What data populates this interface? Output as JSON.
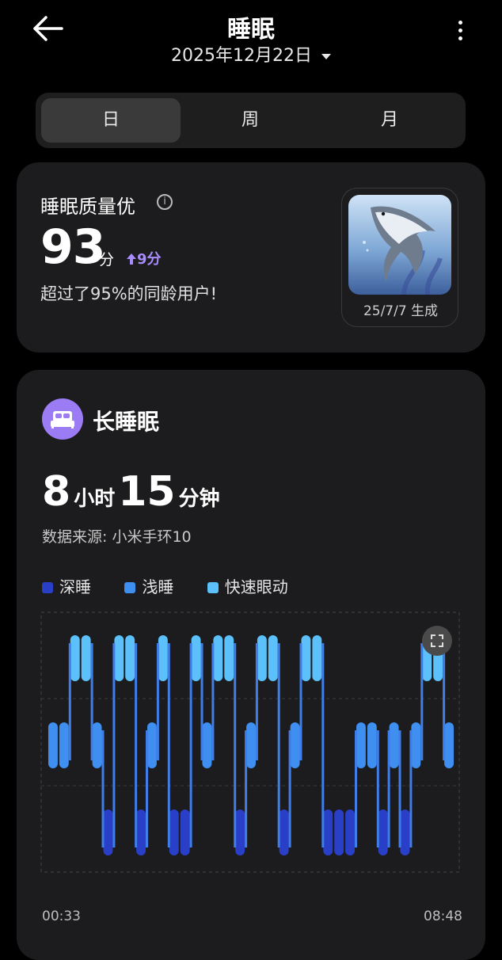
{
  "header": {
    "title": "睡眠",
    "date": "2025年12月22日"
  },
  "tabs": [
    {
      "label": "日",
      "active": true
    },
    {
      "label": "周",
      "active": false
    },
    {
      "label": "月",
      "active": false
    }
  ],
  "quality": {
    "title": "睡眠质量优",
    "score": "93",
    "score_unit": "分",
    "delta": "9分",
    "description": "超过了95%的同龄用户!",
    "image_caption": "25/7/7 生成"
  },
  "sleep": {
    "label": "长睡眠",
    "hours": "8",
    "hours_unit": "小时",
    "minutes": "15",
    "minutes_unit": "分钟",
    "source": "数据来源: 小米手环10",
    "legend": [
      {
        "name": "深睡",
        "color": "#2a3fc8"
      },
      {
        "name": "浅睡",
        "color": "#3f8ff0"
      },
      {
        "name": "快速眼动",
        "color": "#5cc1fa"
      }
    ],
    "start_time": "00:33",
    "end_time": "08:48"
  },
  "chart_data": {
    "type": "bar",
    "x_start": "00:33",
    "x_end": "08:48",
    "levels": [
      "快速眼动",
      "浅睡",
      "深睡"
    ],
    "stages": [
      "浅睡",
      "浅睡",
      "快速眼动",
      "快速眼动",
      "浅睡",
      "深睡",
      "快速眼动",
      "快速眼动",
      "深睡",
      "浅睡",
      "快速眼动",
      "深睡",
      "深睡",
      "快速眼动",
      "浅睡",
      "快速眼动",
      "快速眼动",
      "深睡",
      "浅睡",
      "快速眼动",
      "快速眼动",
      "深睡",
      "浅睡",
      "快速眼动",
      "快速眼动",
      "深睡",
      "深睡",
      "深睡",
      "浅睡",
      "浅睡",
      "深睡",
      "浅睡",
      "深睡",
      "浅睡",
      "快速眼动",
      "快速眼动",
      "浅睡"
    ]
  }
}
